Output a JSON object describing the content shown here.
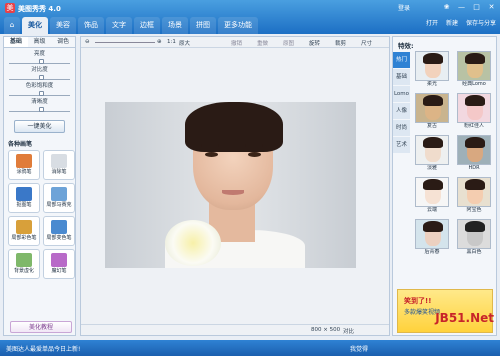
{
  "window": {
    "title": "美图秀秀 4.0",
    "login": "登录"
  },
  "tabs": {
    "home": "⌂",
    "items": [
      "美化",
      "美容",
      "饰品",
      "文字",
      "边框",
      "场景",
      "拼图",
      "更多功能"
    ]
  },
  "toolbar_right": {
    "open": "打开",
    "new": "新建",
    "save": "保存与分享"
  },
  "left_panel": {
    "subtabs": [
      "基础",
      "高级",
      "调色"
    ],
    "sliders": [
      {
        "label": "亮度",
        "value": 0.5
      },
      {
        "label": "对比度",
        "value": 0.5
      },
      {
        "label": "色彩饱和度",
        "value": 0.5
      },
      {
        "label": "清晰度",
        "value": 0.5
      }
    ],
    "auto_beautify": "一键美化",
    "pens_title": "各种画笔",
    "pens": [
      "涂鸦笔",
      "消除笔",
      "抠图笔",
      "局部马赛克",
      "局部彩色笔",
      "局部变色笔",
      "背景虚化",
      "魔幻笔"
    ],
    "tutorial": "美化教程"
  },
  "canvas": {
    "toolbar": [
      "1:1",
      "原大",
      "撤销",
      "重做",
      "原图",
      "旋转",
      "裁剪",
      "尺寸"
    ],
    "size": "800 × 500",
    "compare": "对比",
    "zoom": 0.5
  },
  "right_panel": {
    "title": "特效:",
    "vtabs": [
      "热门",
      "基础",
      "Lomo",
      "人像",
      "时尚",
      "艺术"
    ],
    "effects": [
      "柔光",
      "经典Lomo",
      "复古",
      "粉红佳人",
      "淡雅",
      "HDR",
      "云端",
      "阿宝色",
      "后青春",
      "黑白色"
    ],
    "ad_title": "笑到了!!",
    "ad_sub": "多款爆笑视频"
  },
  "statusbar": {
    "left": "美图达人最爱单品今日上新!",
    "right": "我觉得"
  },
  "watermark": "JB51.Net"
}
